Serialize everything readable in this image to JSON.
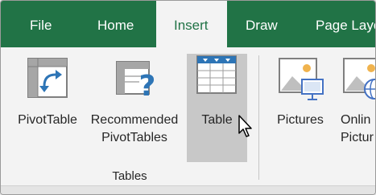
{
  "tabs": [
    {
      "label": "File",
      "active": false
    },
    {
      "label": "Home",
      "active": false
    },
    {
      "label": "Insert",
      "active": true
    },
    {
      "label": "Draw",
      "active": false
    },
    {
      "label": "Page Layo",
      "active": false
    }
  ],
  "ribbon": {
    "commands": {
      "pivottable": {
        "label": "PivotTable",
        "icon": "pivottable-icon"
      },
      "recommended": {
        "label_line1": "Recommended",
        "label_line2": "PivotTables",
        "icon": "recommended-pivottables-icon"
      },
      "table": {
        "label": "Table",
        "icon": "table-icon",
        "state": "hovered"
      },
      "pictures": {
        "label": "Pictures",
        "icon": "pictures-icon"
      },
      "online": {
        "label_line1": "Onlin",
        "label_line2": "Pictur",
        "icon": "online-pictures-icon"
      }
    },
    "group_label": "Tables"
  },
  "colors": {
    "accent": "#217346",
    "table_blue": "#2e75b6",
    "picture_orange": "#f0b34e",
    "picture_blue": "#4472c4",
    "question_blue": "#2e75b6"
  }
}
